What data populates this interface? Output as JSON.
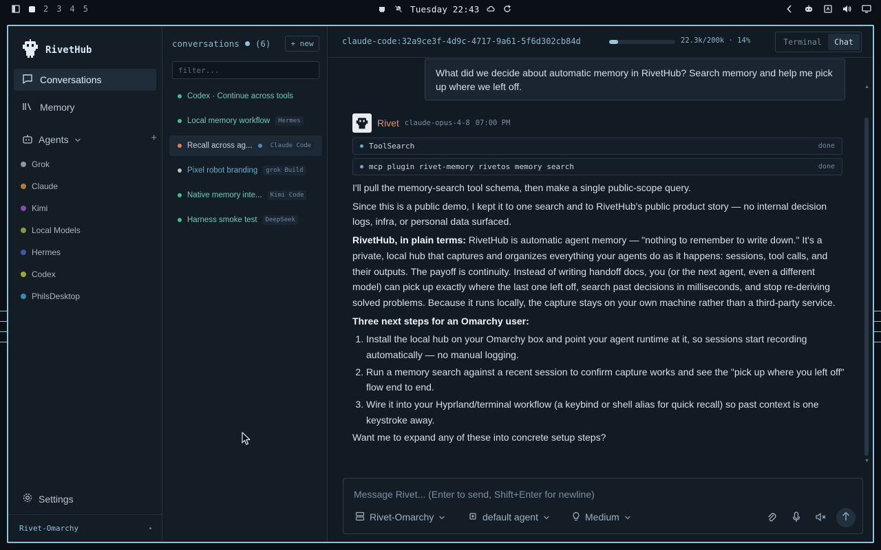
{
  "topbar": {
    "workspaces": [
      "2",
      "3",
      "4",
      "5"
    ],
    "clock": "Tuesday 22:43"
  },
  "sidebar": {
    "brand": "RivetHub",
    "nav": [
      {
        "label": "Conversations",
        "icon": "chat-icon",
        "active": true
      },
      {
        "label": "Memory",
        "icon": "library-icon",
        "active": false
      }
    ],
    "agents_label": "Agents",
    "agents": [
      {
        "name": "Grok",
        "color": "#8a96a3"
      },
      {
        "name": "Claude",
        "color": "#b07a3a"
      },
      {
        "name": "Kimi",
        "color": "#8a4aa8"
      },
      {
        "name": "Local Models",
        "color": "#8a9a3a"
      },
      {
        "name": "Hermes",
        "color": "#3a5aa8"
      },
      {
        "name": "Codex",
        "color": "#9aa83a"
      },
      {
        "name": "PhilsDesktop",
        "color": "#3a8ab0"
      }
    ],
    "settings_label": "Settings",
    "footer": "Rivet-Omarchy"
  },
  "conversations": {
    "title": "conversations",
    "count": "(6)",
    "new_label": "+ new",
    "filter_placeholder": "filter...",
    "items": [
      {
        "title": "Codex · Continue across tools",
        "tag": "",
        "dot": "#3fbf8a",
        "active": false
      },
      {
        "title": "Local memory workflow",
        "tag": "Hermes",
        "dot": "#3fbf8a",
        "active": false
      },
      {
        "title": "Recall across ag...",
        "tag": "Claude Code",
        "dot": "#e0805a",
        "active": true
      },
      {
        "title": "Pixel robot branding",
        "tag": "grok Build",
        "dot": "#b8c2cc",
        "active": false
      },
      {
        "title": "Native memory inte...",
        "tag": "Kimi Code",
        "dot": "#3fbf8a",
        "active": false
      },
      {
        "title": "Harness smoke test",
        "tag": "DeepSeek",
        "dot": "#3fbf8a",
        "active": false
      }
    ]
  },
  "main": {
    "session_id": "claude-code:32a9ce3f-4d9c-4717-9a61-5f6d302cb84d",
    "context_usage": "22.3k/200k · 14%",
    "context_fraction": 0.14,
    "modes": {
      "terminal": "Terminal",
      "chat": "Chat"
    },
    "user_message": "What did we decide about automatic memory in RivetHub? Search memory and help me pick up where we left off.",
    "assistant": {
      "name": "Rivet",
      "model": "claude-opus-4-8",
      "time": "07:00 PM",
      "tools": [
        {
          "name": "ToolSearch",
          "status": "done"
        },
        {
          "name": "mcp plugin rivet-memory rivetos memory search",
          "status": "done"
        }
      ],
      "p1": "I'll pull the memory-search tool schema, then make a single public-scope query.",
      "p2": "Since this is a public demo, I kept it to one search and to RivetHub's public product story — no internal decision logs, infra, or personal data surfaced.",
      "p3_bold": "RivetHub, in plain terms:",
      "p3": " RivetHub is automatic agent memory — \"nothing to remember to write down.\" It's a private, local hub that captures and organizes everything your agents do as it happens: sessions, tool calls, and their outputs. The payoff is continuity. Instead of writing handoff docs, you (or the next agent, even a different model) can pick up exactly where the last one left off, search past decisions in milliseconds, and stop re-deriving solved problems. Because it runs locally, the capture stays on your own machine rather than a third-party service.",
      "steps_title": "Three next steps for an Omarchy user:",
      "steps": [
        "Install the local hub on your Omarchy box and point your agent runtime at it, so sessions start recording automatically — no manual logging.",
        "Run a memory search against a recent session to confirm capture works and see the \"pick up where you left off\" flow end to end.",
        "Wire it into your Hyprland/terminal workflow (a keybind or shell alias for quick recall) so past context is one keystroke away."
      ],
      "closing": "Want me to expand any of these into concrete setup steps?"
    },
    "composer": {
      "placeholder": "Message Rivet... (Enter to send, Shift+Enter for newline)",
      "host": "Rivet-Omarchy",
      "agent": "default agent",
      "effort": "Medium"
    }
  }
}
